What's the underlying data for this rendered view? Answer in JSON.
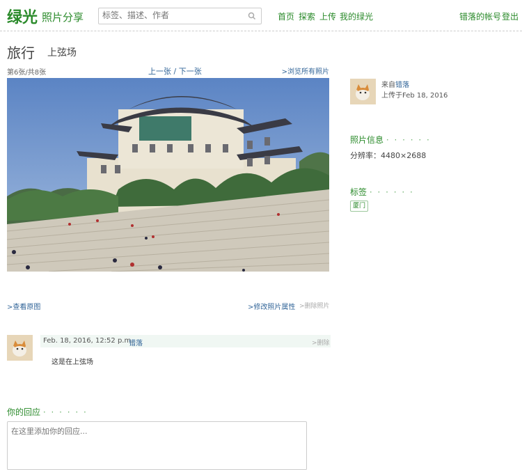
{
  "header": {
    "logo": "绿光",
    "subtitle": "照片分享",
    "search_placeholder": "标签、描述、作者",
    "nav": [
      "首页",
      "探索",
      "上传",
      "我的绿光"
    ],
    "account": "错落的帐号",
    "logout": "登出"
  },
  "photo": {
    "title": "旅行",
    "caption": "上弦场",
    "counter": "第6张/共8张",
    "prev": "上一张",
    "separator": " / ",
    "next": "下一张",
    "browse_all": ">浏览所有照片",
    "view_original": ">查看原图",
    "edit_props": ">修改照片属性",
    "delete": ">删除照片"
  },
  "sidebar": {
    "from_prefix": "来自",
    "from_user": "错落",
    "uploaded": "上传于Feb 18, 2016",
    "info_title": "照片信息",
    "info_dots": "· · · · · ·",
    "resolution": "分辨率：4480×2688",
    "tags_title": "标签",
    "tags_dots": "· · · · · ·",
    "tags": [
      "厦门"
    ]
  },
  "comment": {
    "date": "Feb. 18, 2016, 12:52 p.m.",
    "user": "错落",
    "delete": ">删除",
    "text": "这是在上弦场"
  },
  "reply": {
    "title": "你的回应",
    "dots": "· · · · · ·",
    "placeholder": "在这里添加你的回应..."
  },
  "colors": {
    "brand": "#2a8a2a",
    "link": "#336699"
  }
}
